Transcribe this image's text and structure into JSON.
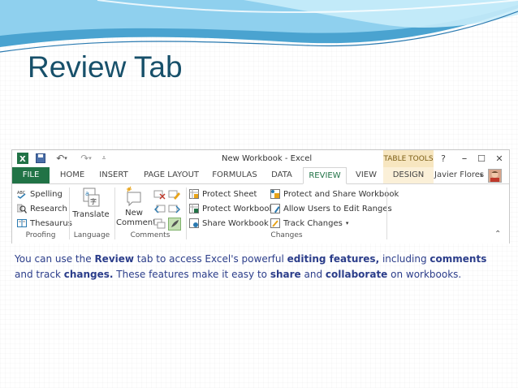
{
  "slide": {
    "title": "Review Tab",
    "description": [
      {
        "t": "You can use the ",
        "b": false
      },
      {
        "t": "Review",
        "b": true
      },
      {
        "t": " tab to access Excel's powerful ",
        "b": false
      },
      {
        "t": "editing features,",
        "b": true
      },
      {
        "t": " including ",
        "b": false
      },
      {
        "t": "comments",
        "b": true
      },
      {
        "t": " and track ",
        "b": false
      },
      {
        "t": "changes.",
        "b": true
      },
      {
        "t": " These features make it easy to ",
        "b": false
      },
      {
        "t": "share",
        "b": true
      },
      {
        "t": " and ",
        "b": false
      },
      {
        "t": "collaborate",
        "b": true
      },
      {
        "t": " on workbooks.",
        "b": false
      }
    ]
  },
  "window": {
    "title": "New Workbook - Excel",
    "table_tools": "TABLE TOOLS",
    "user": "Javier Flores",
    "tabs": [
      "FILE",
      "HOME",
      "INSERT",
      "PAGE LAYOUT",
      "FORMULAS",
      "DATA",
      "REVIEW",
      "VIEW",
      "DESIGN"
    ],
    "active_tab": "REVIEW"
  },
  "ribbon": {
    "proofing": {
      "label": "Proofing",
      "spelling": "Spelling",
      "research": "Research",
      "thesaurus": "Thesaurus"
    },
    "language": {
      "label": "Language",
      "translate": "Translate"
    },
    "comments": {
      "label": "Comments",
      "new_comment_line1": "New",
      "new_comment_line2": "Comment"
    },
    "changes": {
      "label": "Changes",
      "protect_sheet": "Protect Sheet",
      "protect_workbook": "Protect Workbook",
      "share_workbook": "Share Workbook",
      "protect_share": "Protect and Share Workbook",
      "allow_users": "Allow Users to Edit Ranges",
      "track_changes": "Track Changes"
    }
  },
  "colors": {
    "excel_green": "#217346",
    "title_blue": "#17506a",
    "desc_blue": "#2b3d8a",
    "table_tools": "#f7e6c0"
  }
}
